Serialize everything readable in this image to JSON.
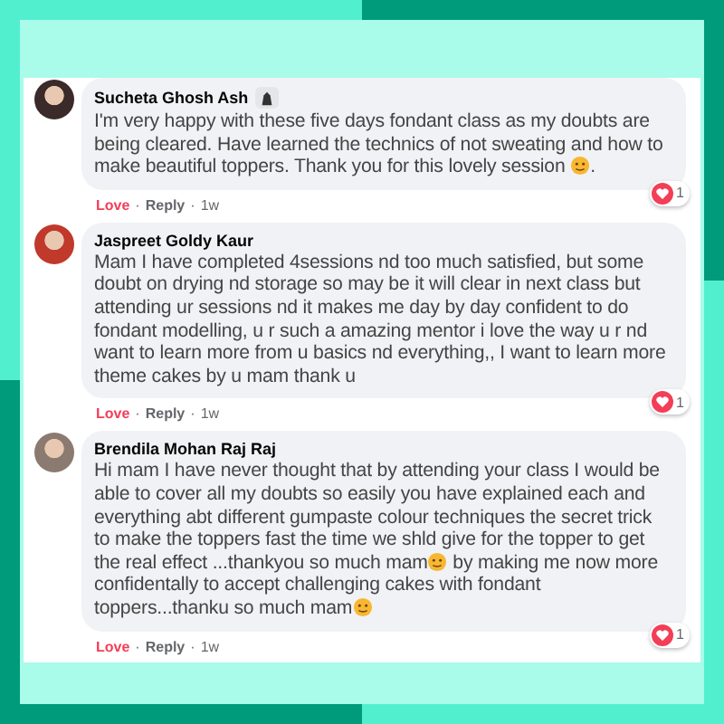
{
  "comments": [
    {
      "author": "Sucheta Ghosh Ash",
      "author_badge": true,
      "segments": [
        {
          "kind": "text",
          "text": "I'm very happy with these five days fondant class as my doubts are being cleared. Have learned the technics of not sweating and how to make beautiful toppers. Thank you for this lovely session "
        },
        {
          "kind": "emoji"
        },
        {
          "kind": "text",
          "text": "."
        }
      ],
      "reaction_label": "Love",
      "separator_1": "·",
      "reply": "Reply",
      "separator_2": "·",
      "time": "1w",
      "reaction_count": "1"
    },
    {
      "author": "Jaspreet Goldy Kaur",
      "author_badge": false,
      "segments": [
        {
          "kind": "text",
          "text": "Mam I have completed 4sessions nd too much satisfied, but some doubt on drying nd storage so may be it will clear in next class but attending ur sessions nd it makes me day by day confident to do fondant modelling, u r such a amazing mentor i love the way u r nd want to learn more from u basics nd everything,, I want to learn more theme cakes by u mam thank u"
        }
      ],
      "reaction_label": "Love",
      "separator_1": "·",
      "reply": "Reply",
      "separator_2": "·",
      "time": "1w",
      "reaction_count": "1"
    },
    {
      "author": "Brendila Mohan Raj Raj",
      "author_badge": false,
      "segments": [
        {
          "kind": "text",
          "text": "Hi mam I have never thought that by attending your class I would be able to cover all my doubts so easily you have explained each and everything abt different gumpaste colour techniques the secret trick to make the toppers fast the time we shld give for the topper to get the real effect ...thankyou so much mam"
        },
        {
          "kind": "emoji"
        },
        {
          "kind": "text",
          "text": " by making me now more confidentally to accept challenging cakes with fondant toppers...thanku so much mam"
        },
        {
          "kind": "emoji"
        }
      ],
      "reaction_label": "Love",
      "separator_1": "·",
      "reply": "Reply",
      "separator_2": "·",
      "time": "1w",
      "reaction_count": "1"
    }
  ]
}
